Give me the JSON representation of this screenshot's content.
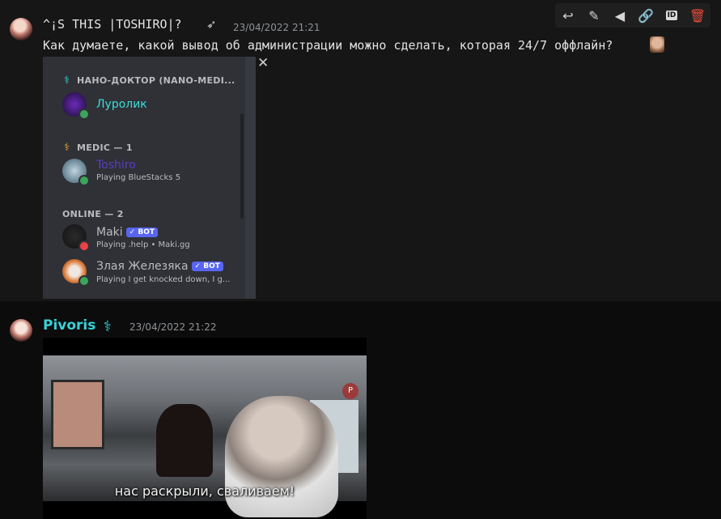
{
  "message1": {
    "author": "^¡S THIS |TOSHIRO|?",
    "badge_icon": "feather-badge-icon",
    "timestamp": "23/04/2022 21:21",
    "text": "Как думаете, какой вывод об администрации можно сделать, которая 24/7 оффлайн?",
    "embed": {
      "categories": [
        {
          "label": "НАНО-ДОКТОР (NANO-MEDI...",
          "members": [
            {
              "name": "Луролик",
              "name_color": "#3ddbd9",
              "status": ""
            }
          ]
        },
        {
          "label": "MEDIC — 1",
          "members": [
            {
              "name": "Toshiro",
              "name_color": "#5b3cc4",
              "status": "Playing BlueStacks 5"
            }
          ]
        },
        {
          "label": "ONLINE — 2",
          "members": [
            {
              "name": "Maki",
              "name_color": "#b9bbbe",
              "bot": "✓ BOT",
              "status": "Playing .help • Maki.gg"
            },
            {
              "name": "Злая Железяка",
              "name_color": "#b9bbbe",
              "bot": "✓ BOT",
              "status": "Playing I get knocked down, I g..."
            }
          ]
        }
      ]
    }
  },
  "message2": {
    "author": "Pivoris",
    "timestamp": "23/04/2022 21:22",
    "video": {
      "subtitle": "нас раскрыли, сваливаем!",
      "logo": "P"
    }
  },
  "toolbar": {
    "items": [
      "reply-icon",
      "edit-icon",
      "tag-icon",
      "link-icon",
      "id-icon",
      "delete-icon"
    ],
    "id_label": "ID"
  },
  "colors": {
    "accent": "#39d0d8",
    "background": "#0c0c0c",
    "delete": "#e74c3c",
    "bot_badge": "#5865f2"
  }
}
